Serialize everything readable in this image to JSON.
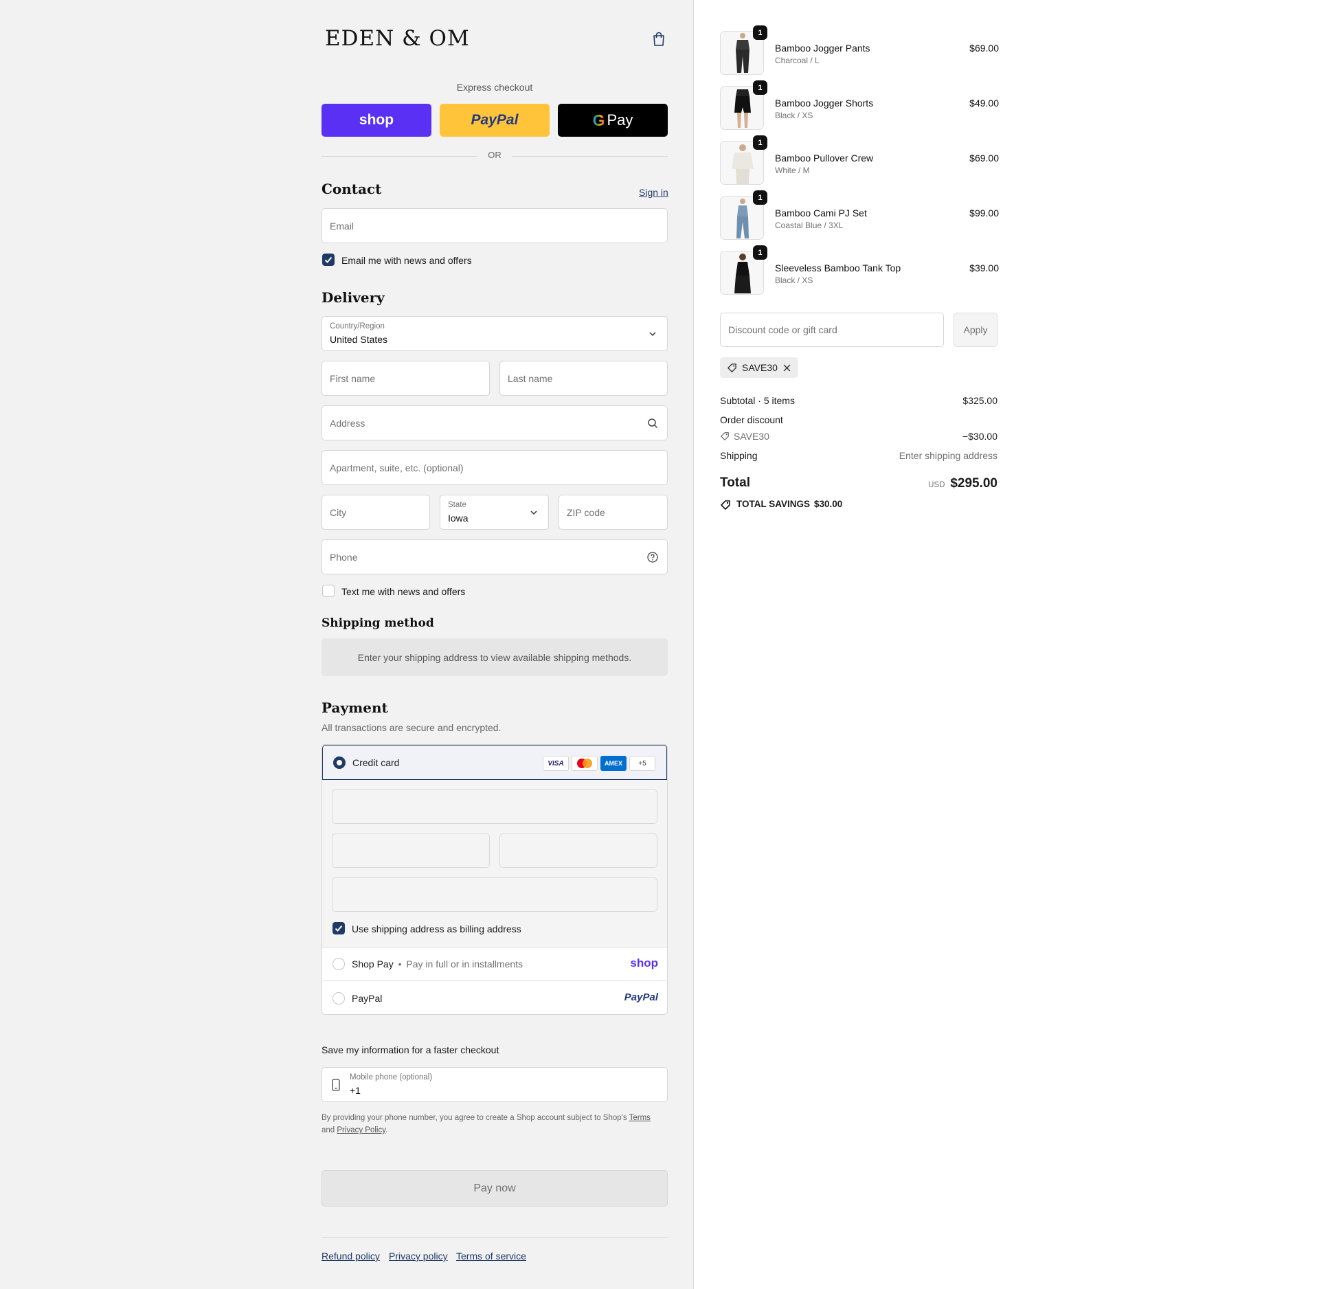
{
  "brand": {
    "logo": "EDEN & OM"
  },
  "express": {
    "title": "Express checkout",
    "shop": "shop",
    "paypal": "PayPal",
    "gpay": "Pay",
    "or": "OR"
  },
  "contact": {
    "heading": "Contact",
    "sign_in": "Sign in",
    "email_placeholder": "Email",
    "news_label": "Email me with news and offers",
    "news_checked": true
  },
  "delivery": {
    "heading": "Delivery",
    "country_label": "Country/Region",
    "country_value": "United States",
    "first_name": "First name",
    "last_name": "Last name",
    "address": "Address",
    "apartment": "Apartment, suite, etc. (optional)",
    "city": "City",
    "state_label": "State",
    "state_value": "Iowa",
    "zip": "ZIP code",
    "phone": "Phone",
    "text_label": "Text me with news and offers",
    "text_checked": false
  },
  "shipping_method": {
    "heading": "Shipping method",
    "notice": "Enter your shipping address to view available shipping methods."
  },
  "payment": {
    "heading": "Payment",
    "subtitle": "All transactions are secure and encrypted.",
    "credit_card": "Credit card",
    "card_icons": [
      "VISA",
      "mastercard",
      "AMEX",
      "+5"
    ],
    "billing_label": "Use shipping address as billing address",
    "billing_checked": true,
    "shop_pay": "Shop Pay",
    "shop_pay_sub": "Pay in full or in installments",
    "shop_logo": "shop",
    "paypal": "PayPal",
    "paypal_logo": "PayPal"
  },
  "save_info": {
    "heading": "Save my information for a faster checkout",
    "mobile_label": "Mobile phone (optional)",
    "mobile_value": "+1",
    "legal_prefix": "By providing your phone number, you agree to create a Shop account subject to Shop's",
    "terms": "Terms",
    "and": "and",
    "privacy": "Privacy Policy",
    "period": "."
  },
  "pay_now": "Pay now",
  "footer": {
    "refund": "Refund policy",
    "privacy": "Privacy policy",
    "terms": "Terms of service"
  },
  "cart": {
    "items": [
      {
        "name": "Bamboo Jogger Pants",
        "variant": "Charcoal / L",
        "price": "$69.00",
        "qty": "1"
      },
      {
        "name": "Bamboo Jogger Shorts",
        "variant": "Black / XS",
        "price": "$49.00",
        "qty": "1"
      },
      {
        "name": "Bamboo Pullover Crew",
        "variant": "White / M",
        "price": "$69.00",
        "qty": "1"
      },
      {
        "name": "Bamboo Cami PJ Set",
        "variant": "Coastal Blue / 3XL",
        "price": "$99.00",
        "qty": "1"
      },
      {
        "name": "Sleeveless Bamboo Tank Top",
        "variant": "Black / XS",
        "price": "$39.00",
        "qty": "1"
      }
    ],
    "discount_placeholder": "Discount code or gift card",
    "apply": "Apply",
    "applied_code": "SAVE30",
    "subtotal_label": "Subtotal · 5 items",
    "subtotal_value": "$325.00",
    "order_discount_label": "Order discount",
    "discount_code": "SAVE30",
    "discount_value": "−$30.00",
    "shipping_label": "Shipping",
    "shipping_value": "Enter shipping address",
    "total_label": "Total",
    "currency": "USD",
    "total_value": "$295.00",
    "savings_label": "TOTAL SAVINGS",
    "savings_value": "$30.00"
  },
  "colors": {
    "accent": "#1f3a66",
    "shop": "#5a31f4",
    "paypal_yellow": "#ffc439"
  }
}
